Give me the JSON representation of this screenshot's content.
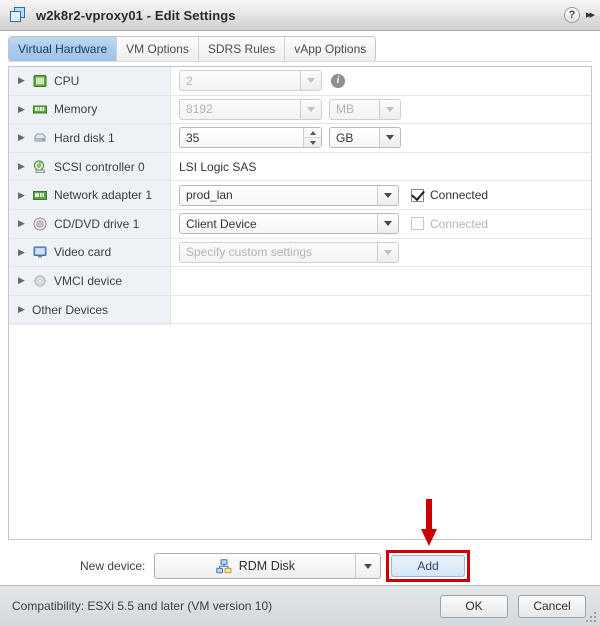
{
  "window": {
    "title": "w2k8r2-vproxy01 - Edit Settings",
    "icon": "vm-icon",
    "help_icon": "?",
    "expand_icon": "▸▸"
  },
  "tabs": [
    {
      "label": "Virtual Hardware",
      "selected": true
    },
    {
      "label": "VM Options",
      "selected": false
    },
    {
      "label": "SDRS Rules",
      "selected": false
    },
    {
      "label": "vApp Options",
      "selected": false
    }
  ],
  "devices": [
    {
      "name": "CPU",
      "icon": "cpu-icon",
      "value": "2",
      "control": "select-disabled",
      "extra": "info"
    },
    {
      "name": "Memory",
      "icon": "memory-icon",
      "value": "8192",
      "control": "select-disabled",
      "unit": "MB",
      "unit_disabled": true
    },
    {
      "name": "Hard disk 1",
      "icon": "harddisk-icon",
      "value": "35",
      "control": "spinner",
      "unit": "GB",
      "unit_disabled": false
    },
    {
      "name": "SCSI controller 0",
      "icon": "scsi-icon",
      "value": "LSI Logic SAS",
      "control": "text"
    },
    {
      "name": "Network adapter 1",
      "icon": "network-icon",
      "value": "prod_lan",
      "control": "select",
      "checkbox": {
        "label": "Connected",
        "checked": true,
        "enabled": true
      }
    },
    {
      "name": "CD/DVD drive 1",
      "icon": "cddvd-icon",
      "value": "Client Device",
      "control": "select",
      "checkbox": {
        "label": "Connected",
        "checked": false,
        "enabled": false
      }
    },
    {
      "name": "Video card",
      "icon": "videocard-icon",
      "value": "Specify custom settings",
      "control": "select-disabled"
    },
    {
      "name": "VMCI device",
      "icon": "vmci-icon",
      "value": "",
      "control": "none"
    },
    {
      "name": "Other Devices",
      "icon": "none",
      "value": "",
      "control": "none"
    }
  ],
  "new_device": {
    "label": "New device:",
    "selected": "RDM Disk",
    "icon": "rdm-disk-icon",
    "add_label": "Add",
    "highlighted": true,
    "annotation_color": "#cc0000"
  },
  "footer": {
    "compatibility": "Compatibility: ESXi 5.5 and later (VM version 10)",
    "ok_label": "OK",
    "cancel_label": "Cancel"
  },
  "colors": {
    "accent": "#9dc4e9",
    "annotation": "#cc0000",
    "panel_bg": "#eef2f6"
  }
}
